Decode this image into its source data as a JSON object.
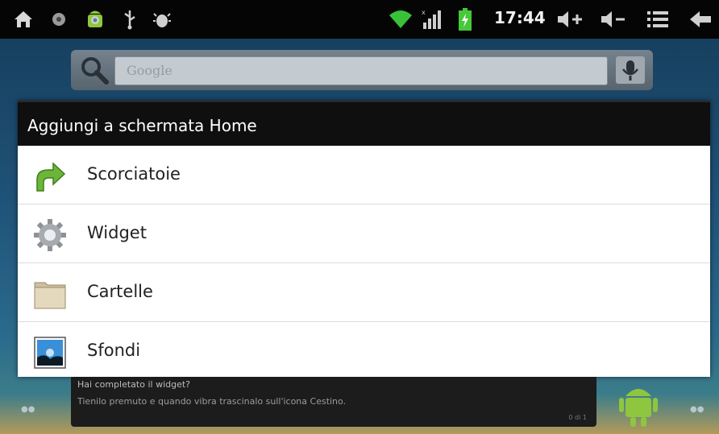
{
  "status_bar": {
    "time": "17:44",
    "left_icons": [
      "home-icon",
      "record-icon",
      "android-icon",
      "usb-icon",
      "debug-icon"
    ],
    "right_icons": [
      "wifi-icon",
      "signal-icon",
      "battery-charging-icon",
      "volume-up-icon",
      "volume-down-icon",
      "menu-icon",
      "back-icon"
    ]
  },
  "search": {
    "placeholder": "Google"
  },
  "dialog": {
    "title": "Aggiungi a schermata Home",
    "items": [
      {
        "label": "Scorciatoie",
        "icon": "shortcut-arrow-icon"
      },
      {
        "label": "Widget",
        "icon": "gear-icon"
      },
      {
        "label": "Cartelle",
        "icon": "folder-icon"
      },
      {
        "label": "Sfondi",
        "icon": "wallpaper-icon"
      }
    ]
  },
  "hint": {
    "line1": "Hai completato il widget?",
    "line2": "Tienilo premuto e quando vibra trascinalo sull'icona Cestino.",
    "line3": "0 di 1"
  },
  "colors": {
    "status_bar": "#050505",
    "dialog_title_bg": "#0f0f0f",
    "dialog_bg": "#ffffff",
    "wifi": "#39c239",
    "battery": "#47c83a"
  }
}
